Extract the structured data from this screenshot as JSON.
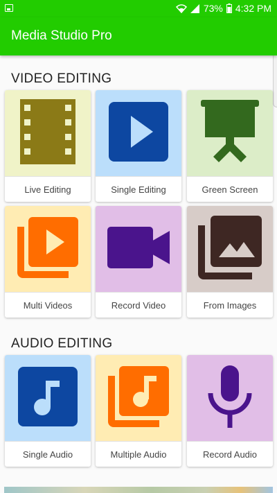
{
  "status_bar": {
    "battery": "73%",
    "time": "4:32 PM"
  },
  "app_bar": {
    "title": "Media Studio Pro"
  },
  "sections": {
    "video": {
      "title": "VIDEO EDITING",
      "tiles": [
        {
          "label": "Live Editing",
          "icon": "film-strip-icon",
          "bg": "#f0f3c8",
          "color": "#8b7a17"
        },
        {
          "label": "Single Editing",
          "icon": "play-icon",
          "bg": "#bbdefb",
          "color": "#0d47a1"
        },
        {
          "label": "Green Screen",
          "icon": "projector-screen-icon",
          "bg": "#dcedc8",
          "color": "#33691e"
        },
        {
          "label": "Multi Videos",
          "icon": "video-library-icon",
          "bg": "#ffecb3",
          "color": "#ff6d00"
        },
        {
          "label": "Record Video",
          "icon": "videocam-icon",
          "bg": "#e1bee7",
          "color": "#4a148c"
        },
        {
          "label": "From Images",
          "icon": "photo-library-icon",
          "bg": "#d7ccc8",
          "color": "#3e2723"
        }
      ]
    },
    "audio": {
      "title": "AUDIO EDITING",
      "tiles": [
        {
          "label": "Single Audio",
          "icon": "music-note-icon",
          "bg": "#bbdefb",
          "color": "#0d47a1"
        },
        {
          "label": "Multiple Audio",
          "icon": "music-library-icon",
          "bg": "#ffecb3",
          "color": "#ff6d00"
        },
        {
          "label": "Record Audio",
          "icon": "microphone-icon",
          "bg": "#e1bee7",
          "color": "#4a148c"
        }
      ]
    }
  }
}
